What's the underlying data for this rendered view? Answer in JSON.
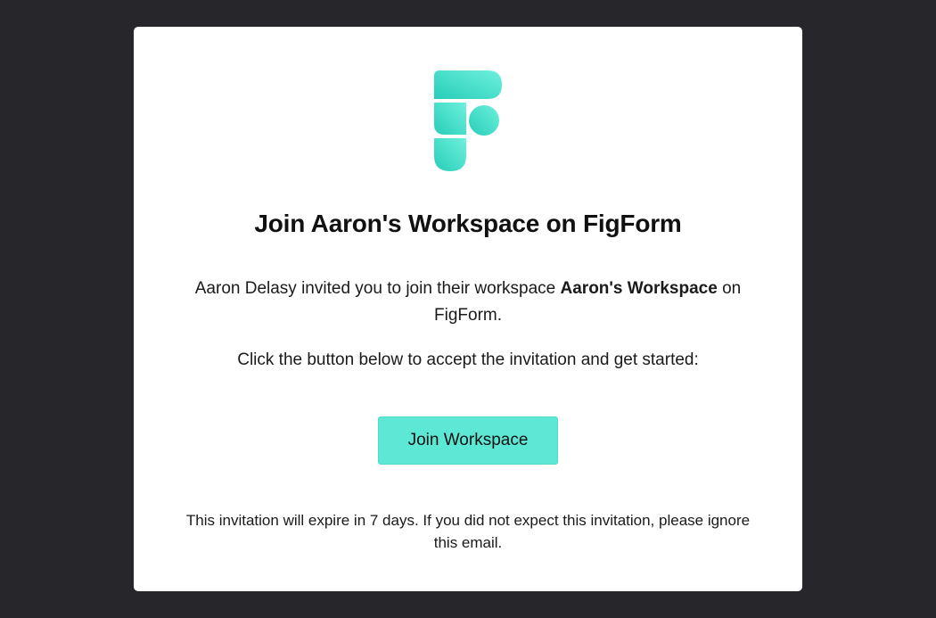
{
  "logo": {
    "name": "FigForm logo",
    "colors": {
      "start": "#2ad1bf",
      "end": "#6ef0da"
    }
  },
  "title": "Join Aaron's Workspace on FigForm",
  "invite": {
    "prefix": "Aaron Delasy invited you to join their workspace ",
    "workspace_name": "Aaron's Workspace",
    "suffix": " on FigForm."
  },
  "instruction": "Click the button below to accept the invitation and get started:",
  "button": {
    "label": "Join Workspace",
    "color": "#5ce8d4"
  },
  "footer": "This invitation will expire in 7 days. If you did not expect this invitation, please ignore this email.",
  "colors": {
    "background": "#26262b",
    "card": "#ffffff",
    "accent": "#5ce8d4"
  }
}
